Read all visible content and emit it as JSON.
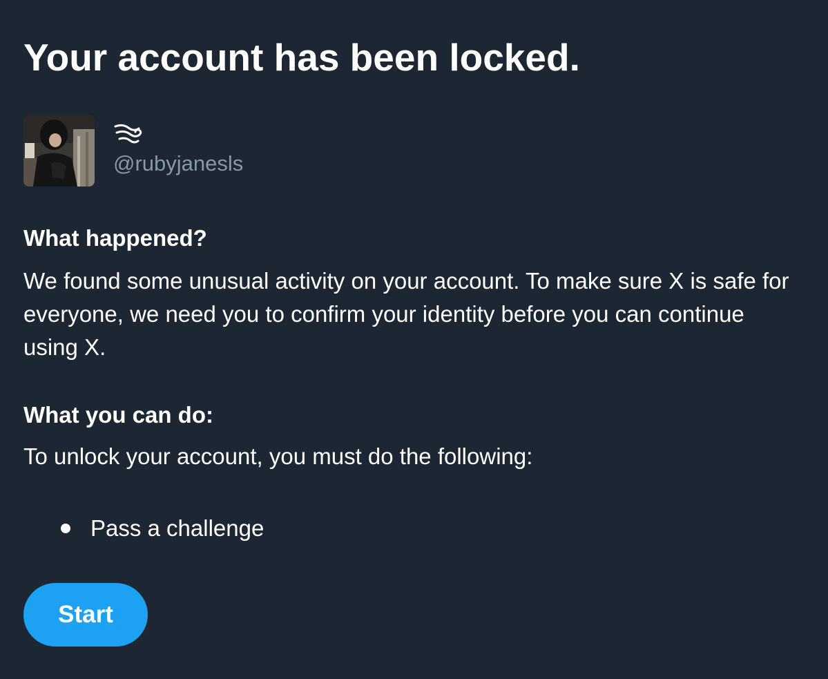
{
  "page": {
    "title": "Your account has been locked."
  },
  "account": {
    "display_name_icon": "wind-swirl-emoji-icon",
    "handle": "@rubyjanesls"
  },
  "what_happened": {
    "heading": "What happened?",
    "body": "We found some unusual activity on your account. To make sure X is safe for everyone, we need you to confirm your identity before you can continue using X."
  },
  "what_you_can_do": {
    "heading": "What you can do:",
    "body": "To unlock your account, you must do the following:",
    "steps": [
      "Pass a challenge"
    ]
  },
  "actions": {
    "start_label": "Start"
  },
  "colors": {
    "background": "#1c2733",
    "text": "#ffffff",
    "secondary_text": "#8899a6",
    "accent": "#1da1f2"
  }
}
